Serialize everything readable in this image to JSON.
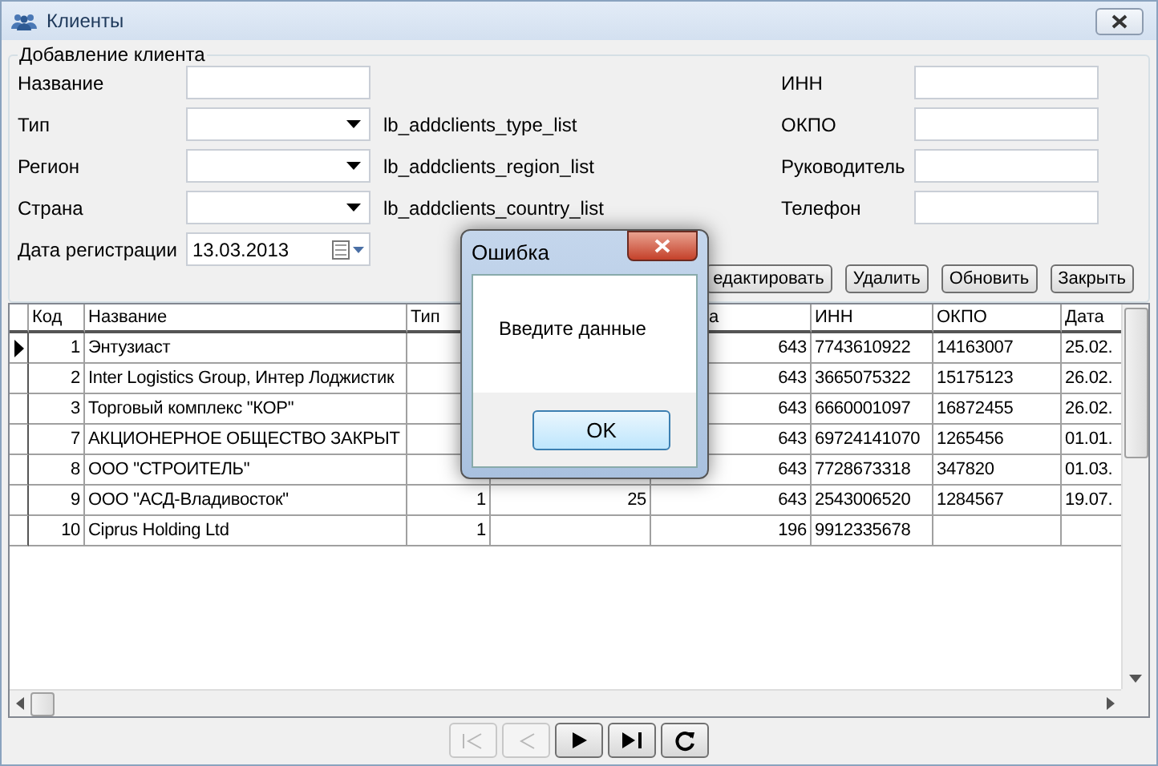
{
  "window": {
    "title": "Клиенты"
  },
  "form": {
    "legend": "Добавление клиента",
    "left_fields": [
      {
        "kind": "text",
        "label": "Название"
      },
      {
        "kind": "combo",
        "label": "Тип",
        "list_label": "lb_addclients_type_list"
      },
      {
        "kind": "combo",
        "label": "Регион",
        "list_label": "lb_addclients_region_list"
      },
      {
        "kind": "combo",
        "label": "Страна",
        "list_label": "lb_addclients_country_list"
      },
      {
        "kind": "date",
        "label": "Дата регистрации",
        "value": "13.03.2013"
      }
    ],
    "right_fields": [
      {
        "label": "ИНН"
      },
      {
        "label": "ОКПО"
      },
      {
        "label": "Руководитель"
      },
      {
        "label": "Телефон"
      }
    ]
  },
  "buttons": [
    "едактировать",
    "Удалить",
    "Обновить",
    "Закрыть"
  ],
  "table": {
    "columns": [
      {
        "label": "Код"
      },
      {
        "label": "Название"
      },
      {
        "label": "Тип"
      },
      {},
      {
        "label": "а",
        "kind": "clipped"
      },
      {
        "label": "ИНН"
      },
      {
        "label": "ОКПО"
      },
      {
        "label": "Дата"
      }
    ],
    "rows": [
      {
        "current": true,
        "kod": "1",
        "nazvanie": "Энтузиаст",
        "column_5": "643",
        "inn": "7743610922",
        "okpo": "14163007",
        "data": "25.02."
      },
      {
        "current": false,
        "kod": "2",
        "nazvanie": "Inter Logistics Group, Интер Лоджистик",
        "column_5": "643",
        "inn": "3665075322",
        "okpo": "15175123",
        "data": "26.02."
      },
      {
        "current": false,
        "kod": "3",
        "nazvanie": "Торговый комплекс \"КОР\"",
        "column_5": "643",
        "inn": "6660001097",
        "okpo": "16872455",
        "data": "26.02."
      },
      {
        "current": false,
        "kod": "7",
        "nazvanie": "АКЦИОНЕРНОЕ ОБЩЕСТВО ЗАКРЫТ",
        "column_5": "643",
        "inn": "69724141070",
        "okpo": "1265456",
        "data": "01.01."
      },
      {
        "current": false,
        "kod": "8",
        "nazvanie": "ООО \"СТРОИТЕЛЬ\"",
        "column_5": "643",
        "inn": "7728673318",
        "okpo": "347820",
        "data": "01.03."
      },
      {
        "current": false,
        "kod": "9",
        "nazvanie": "ООО \"АСД-Владивосток\"",
        "tip": "1",
        "column_4": "25",
        "column_5": "643",
        "inn": "2543006520",
        "okpo": "1284567",
        "data": "19.07."
      },
      {
        "current": false,
        "kod": "10",
        "nazvanie": "Ciprus Holding Ltd",
        "tip": "1",
        "column_5": "196",
        "inn": "9912335678"
      }
    ]
  },
  "navigator": [
    {
      "kind": "first",
      "disabled": true
    },
    {
      "kind": "prev",
      "disabled": true
    },
    {
      "kind": "next",
      "disabled": false
    },
    {
      "kind": "last",
      "disabled": false
    },
    {
      "kind": "refresh",
      "disabled": false
    }
  ],
  "dialog": {
    "title": "Ошибка",
    "message": "Введите данные",
    "button": "OK"
  }
}
